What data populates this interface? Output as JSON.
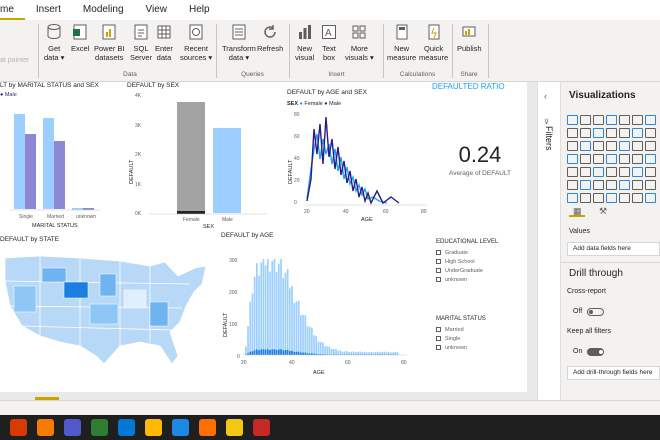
{
  "menu": [
    "me",
    "Insert",
    "Modeling",
    "View",
    "Help"
  ],
  "ribbon": {
    "ghost_text": "at painter",
    "buttons": [
      {
        "line1": "Get",
        "line2": "data ▾"
      },
      {
        "line1": "Excel",
        "line2": ""
      },
      {
        "line1": "Power BI",
        "line2": "datasets"
      },
      {
        "line1": "SQL",
        "line2": "Server"
      },
      {
        "line1": "Enter",
        "line2": "data"
      },
      {
        "line1": "Recent",
        "line2": "sources ▾"
      },
      {
        "line1": "Transform",
        "line2": "data ▾"
      },
      {
        "line1": "Refresh",
        "line2": ""
      },
      {
        "line1": "New",
        "line2": "visual"
      },
      {
        "line1": "Text",
        "line2": "box"
      },
      {
        "line1": "More",
        "line2": "visuals ▾"
      },
      {
        "line1": "New",
        "line2": "measure"
      },
      {
        "line1": "Quick",
        "line2": "measure"
      },
      {
        "line1": "Publish",
        "line2": ""
      }
    ],
    "groups": [
      "Data",
      "Queries",
      "Insert",
      "Calculations",
      "Share"
    ]
  },
  "visuals": {
    "marital_title": "LT by MARITAL STATUS and SEX",
    "marital_legend": "● Male",
    "marital_xlabel": "MARITAL STATUS",
    "marital_cats": [
      "Single",
      "Married",
      "unknown"
    ],
    "sex_title": "DEFAULT by SEX",
    "sex_ylabel": "DEFAULT",
    "sex_xlabel": "SEX",
    "sex_cats": [
      "Female",
      "Male"
    ],
    "sex_yticks": [
      "4K",
      "3K",
      "2K",
      "1K",
      "0K"
    ],
    "agesex_title": "DEFAULT by AGE and SEX",
    "agesex_legend_label": "SEX",
    "agesex_legend": [
      "Female",
      "Male"
    ],
    "agesex_xlabel": "AGE",
    "agesex_ylabel": "DEFAULT",
    "agesex_yticks": [
      "80",
      "60",
      "40",
      "20",
      "0"
    ],
    "agesex_xticks": [
      "20",
      "40",
      "60",
      "80"
    ],
    "ratio_title": "DEFAULTED RATIO",
    "ratio_value": "0.24",
    "ratio_label": "Average of DEFAULT",
    "state_title": "DEFAULT by STATE",
    "age_title": "DEFAULT by AGE",
    "age_ylabel": "DEFAULT",
    "age_xlabel": "AGE",
    "age_yticks": [
      "300",
      "200",
      "100",
      "0"
    ],
    "age_xticks": [
      "20",
      "40",
      "60",
      "80"
    ]
  },
  "slicers": {
    "education_title": "EDUCATIONAL LEVEL",
    "education": [
      "Graduate",
      "High School",
      "UnderGraduate",
      "unknown"
    ],
    "marital_title": "MARITAL STATUS",
    "marital": [
      "Married",
      "Single",
      "unknown"
    ]
  },
  "filters_label": "Filters",
  "viz_pane": {
    "title": "Visualizations",
    "values_label": "Values",
    "values_placeholder": "Add data fields here",
    "drill_title": "Drill through",
    "cross_report": "Cross-report",
    "off_label": "Off",
    "keep_filters": "Keep all filters",
    "on_label": "On",
    "drill_placeholder": "Add drill-through fields here"
  },
  "colors": {
    "male": "#2b1c83",
    "female": "#1aa3ff",
    "accent": "#c9a300",
    "light_bar": "#9ccfff"
  }
}
